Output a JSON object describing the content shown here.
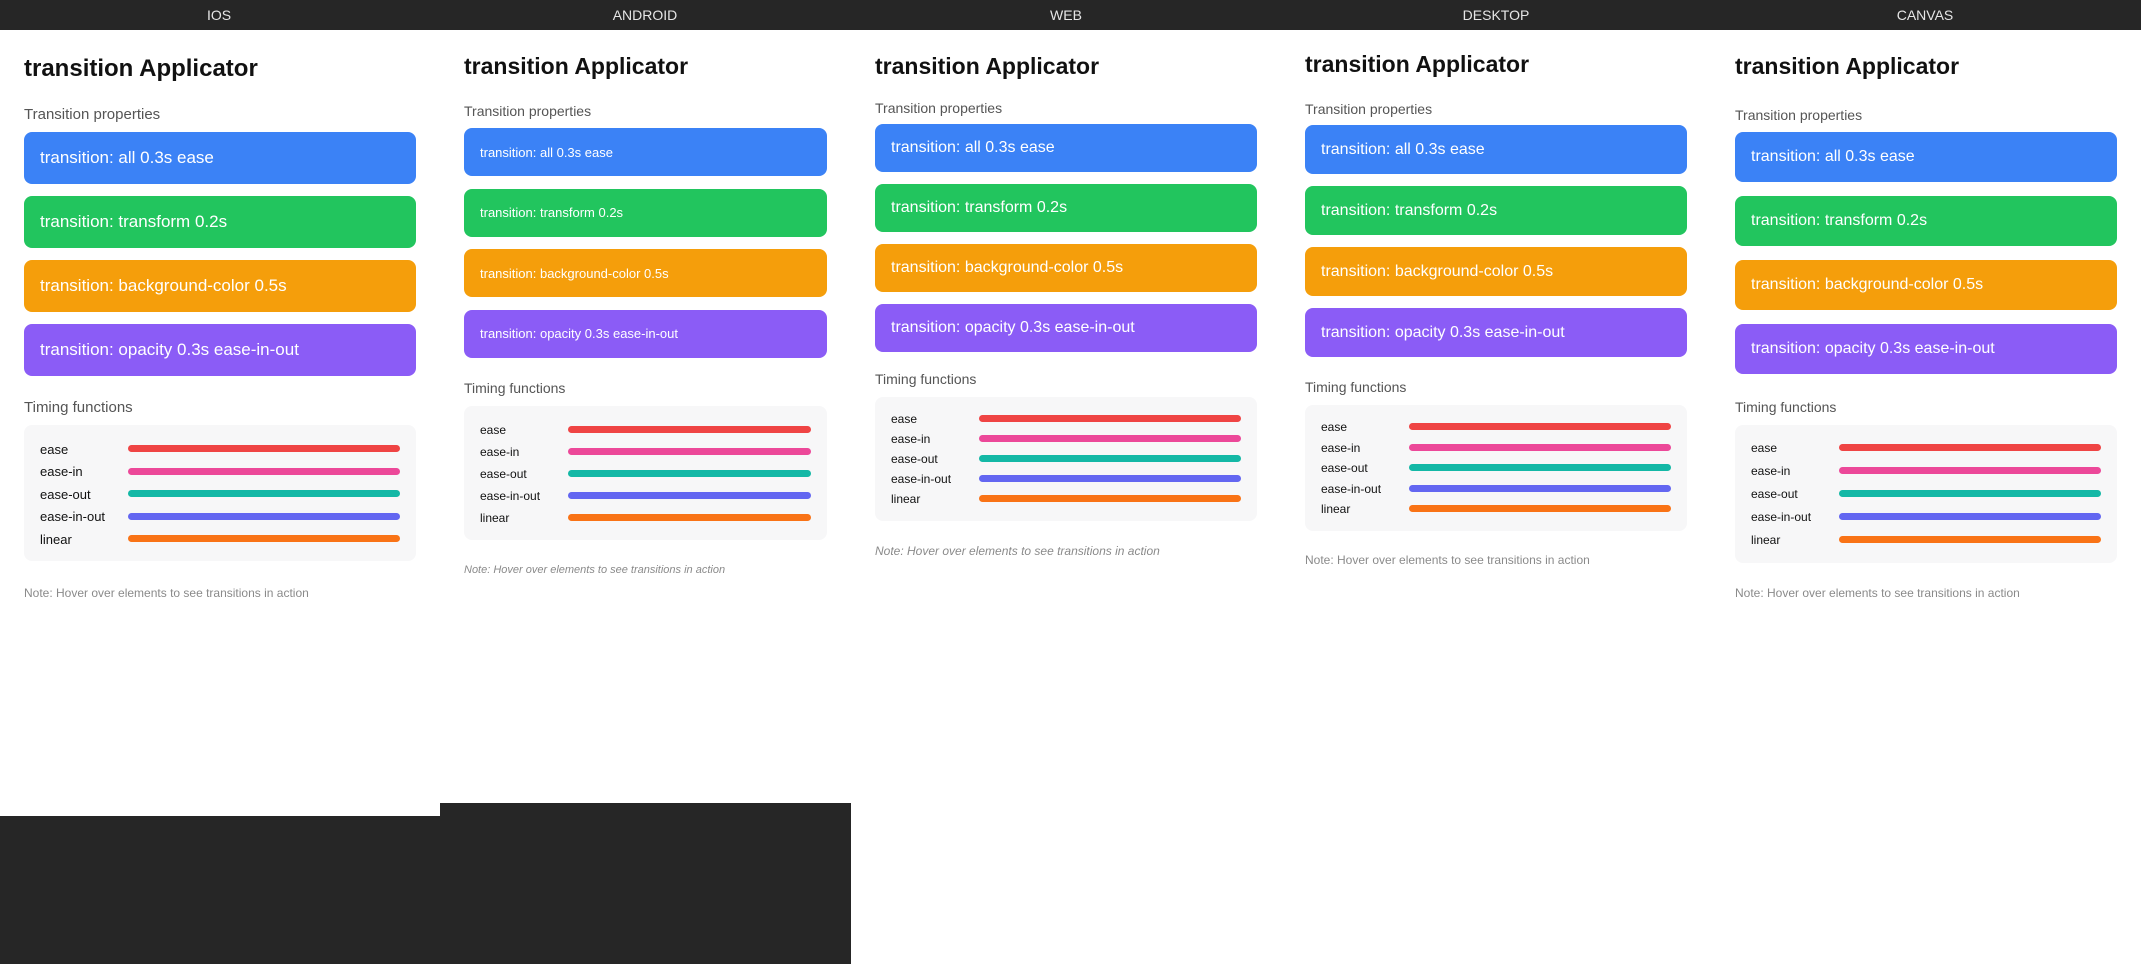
{
  "platforms": [
    "IOS",
    "ANDROID",
    "WEB",
    "DESKTOP",
    "CANVAS"
  ],
  "app": {
    "title": "transition Applicator",
    "properties_label": "Transition properties",
    "timing_label": "Timing functions",
    "note": "Note: Hover over elements to see transitions in action"
  },
  "properties": [
    {
      "label": "transition: all 0.3s ease",
      "color": "#3b82f6"
    },
    {
      "label": "transition: transform 0.2s",
      "color": "#22c55e"
    },
    {
      "label": "transition: background-color 0.5s",
      "color": "#f59e0b"
    },
    {
      "label": "transition: opacity 0.3s ease-in-out",
      "color": "#8b5cf6"
    }
  ],
  "timing": [
    {
      "name": "ease",
      "color": "#ef4444"
    },
    {
      "name": "ease-in",
      "color": "#ec4899"
    },
    {
      "name": "ease-out",
      "color": "#14b8a6"
    },
    {
      "name": "ease-in-out",
      "color": "#6366f1"
    },
    {
      "name": "linear",
      "color": "#f97316"
    }
  ]
}
